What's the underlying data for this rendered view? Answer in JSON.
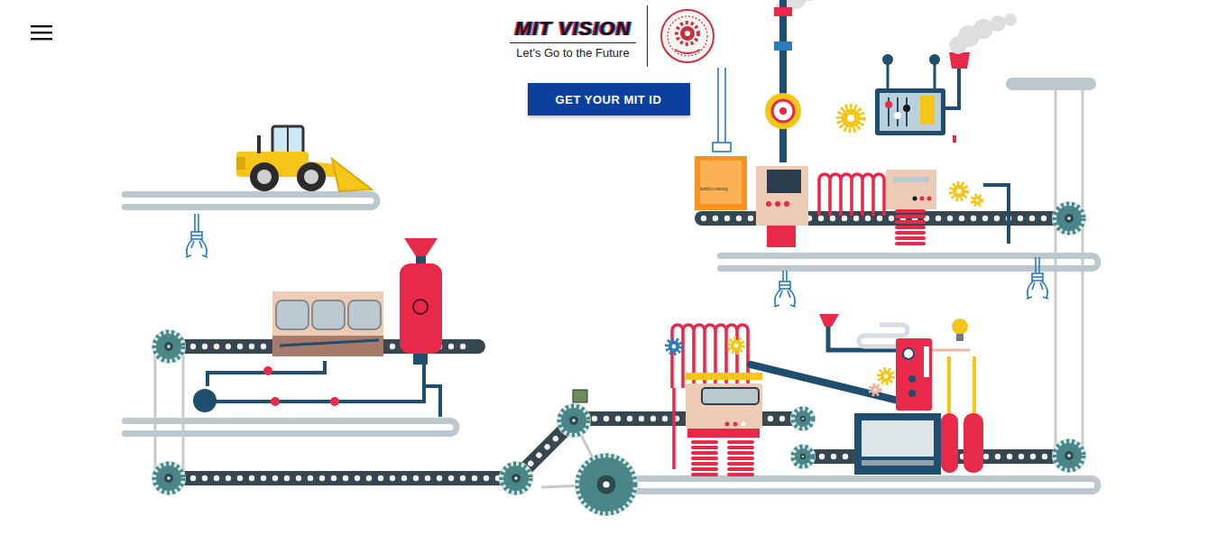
{
  "logo": {
    "title": "MIT VISION",
    "tagline": "Let's Go to the Future"
  },
  "cta": {
    "label": "GET YOUR MIT ID"
  },
  "illustration": {
    "box_label": "Ambicoming"
  }
}
